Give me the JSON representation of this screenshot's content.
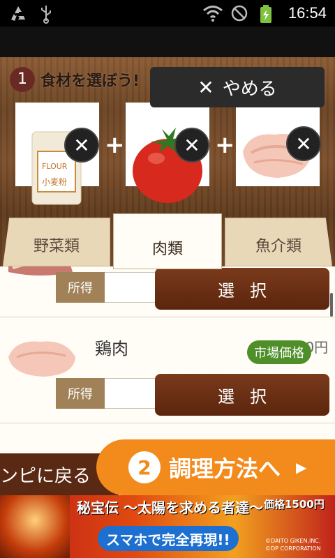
{
  "status_bar": {
    "time": "16:54",
    "icons": [
      "recycle-icon",
      "usb-icon",
      "wifi-icon",
      "no-signal-icon",
      "battery-charging-icon"
    ]
  },
  "step1": {
    "number": "1",
    "label": "食材を選ぼう!"
  },
  "cancel_button": {
    "label": "やめる"
  },
  "selected_ingredients": [
    {
      "name": "小麦粉",
      "flour_label": "FLOUR"
    },
    {
      "name": "トマト"
    },
    {
      "name": "鶏肉"
    }
  ],
  "tabs": [
    {
      "label": "野菜類",
      "active": false
    },
    {
      "label": "肉類",
      "active": true
    },
    {
      "label": "魚介類",
      "active": false
    }
  ],
  "items": [
    {
      "name": "",
      "own_label": "所得",
      "own_value": "",
      "select_label": "選択"
    },
    {
      "name": "鶏肉",
      "price": "500円",
      "badge": "市場価格",
      "own_label": "所得",
      "own_value": "",
      "select_label": "選択"
    }
  ],
  "bottom": {
    "back_label": "ンピに戻る",
    "next_number": "2",
    "next_label": "調理方法へ"
  },
  "ad": {
    "title": "秘宝伝 〜太陽を求める者達〜",
    "price": "価格1500円",
    "subtitle": "スマホで完全再現!!",
    "copyright_1": "©DAITO GIKEN,INC.",
    "copyright_2": "©DP CORPORATION"
  },
  "colors": {
    "accent_orange": "#f28a1c",
    "select_brown": "#5b250d",
    "badge_green": "#4f8f2a"
  }
}
